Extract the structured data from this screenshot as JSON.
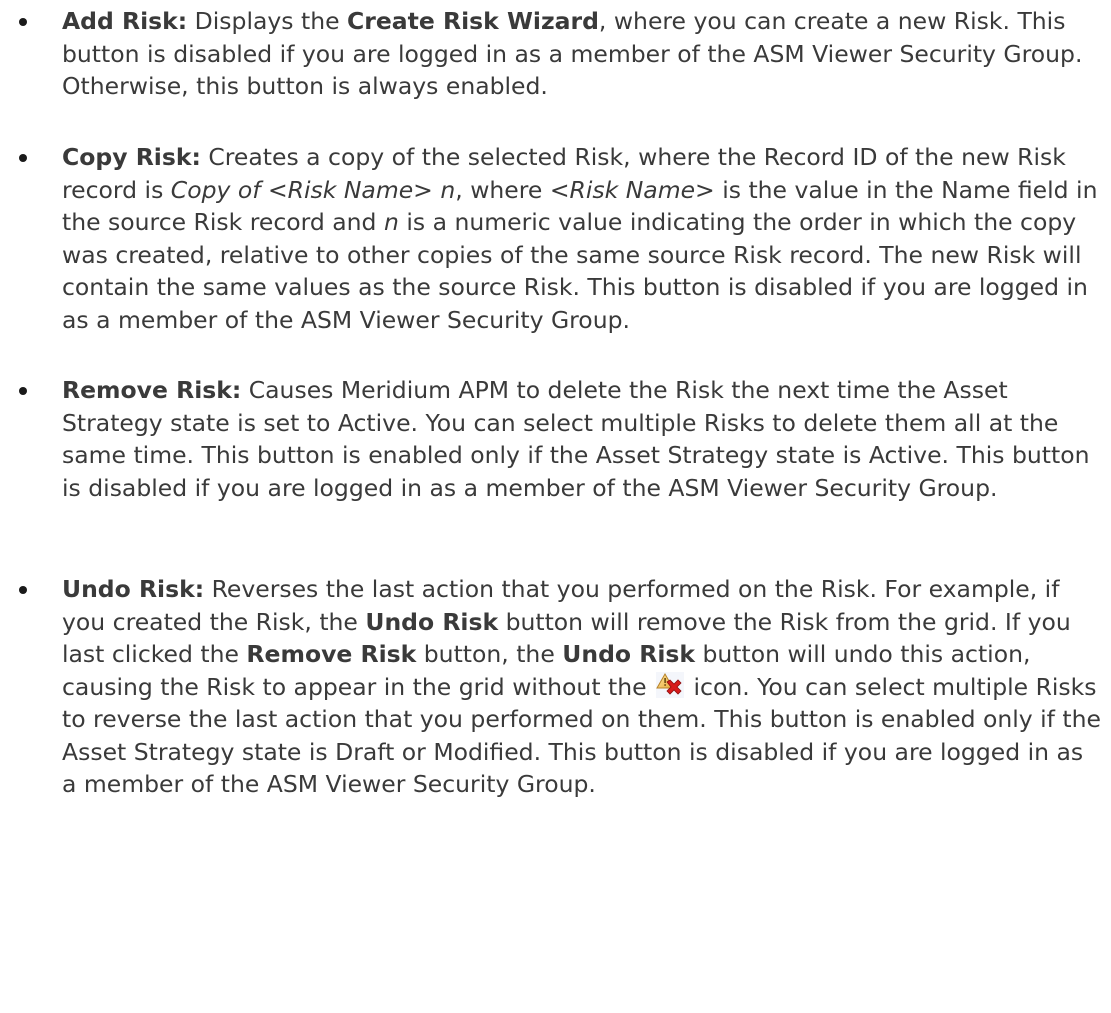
{
  "items": [
    {
      "term": "Add Risk:",
      "t1": " Displays the ",
      "b1": "Create Risk Wizard",
      "t2": ", where you can create a new Risk. This button is disabled if you are logged in as a member of the ASM Viewer Security Group. Otherwise, this button is always enabled."
    },
    {
      "term": "Copy Risk:",
      "t1": " Creates a copy of the selected Risk, where the Record ID of the new Risk record is ",
      "i1": "Copy of <Risk Name> n",
      "t2": ", where ",
      "i2": "<Risk Name>",
      "t3": " is the value in the Name field in the source Risk record and ",
      "i3": "n",
      "t4": " is a numeric value indicating the order in which the copy was created, relative to other copies of the same source Risk record. The new Risk will contain the same values as the source Risk. This button is disabled if you are logged in as a member of the ASM Viewer Security Group."
    },
    {
      "term": "Remove Risk:",
      "t1": " Causes Meridium APM to delete the Risk the next time the Asset Strategy state is set to Active. You can select multiple Risks to delete them all at the same time. This button is enabled only if the Asset Strategy state is Active. This button is disabled if you are logged in as a member of the ASM Viewer Security Group."
    },
    {
      "term": "Undo Risk:",
      "t1": " Reverses the last action that you performed on the Risk. For example, if you created the Risk, the ",
      "b1": "Undo Risk",
      "t2": " button will remove the Risk from the grid. If you last clicked the ",
      "b2": "Remove Risk",
      "t3": " button, the ",
      "b3": "Undo Risk",
      "t4": " button will undo this action, causing the Risk to appear in the grid without the ",
      "icon": "risk-removed-icon",
      "t5": " icon. You can select multiple Risks to reverse the last action that you performed on them. This button is enabled only if the Asset Strategy state is Draft or Modified. This button is disabled if you are logged in as a member of the ASM Viewer Security Group."
    }
  ]
}
